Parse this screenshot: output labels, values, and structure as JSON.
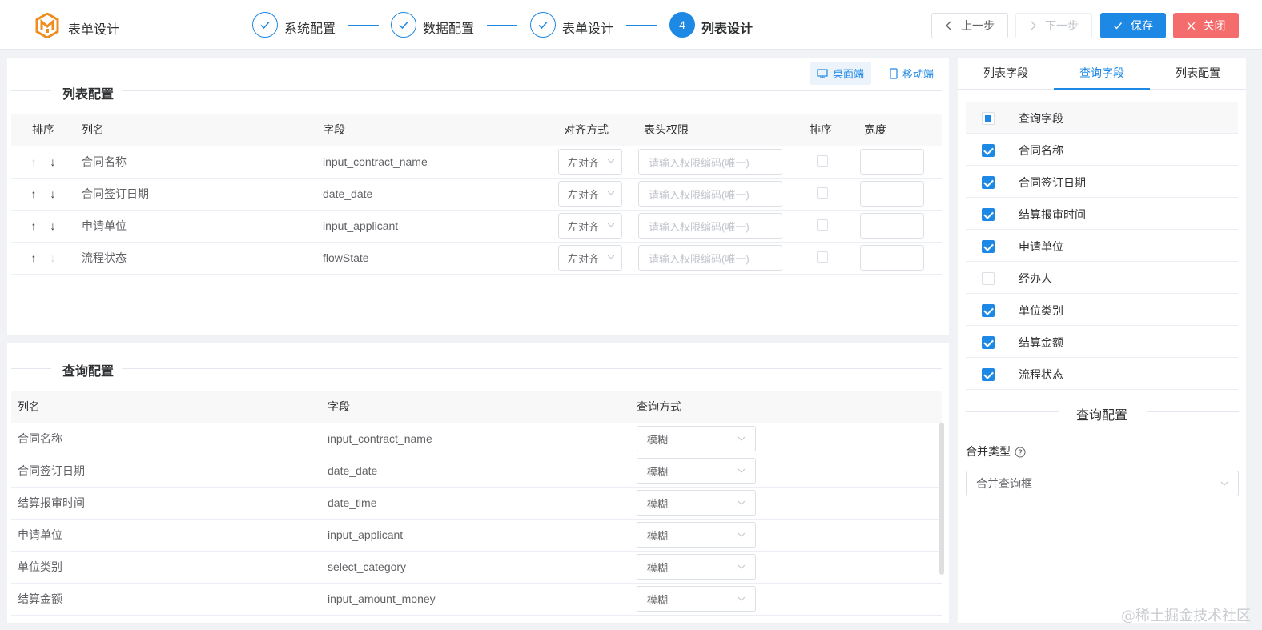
{
  "header": {
    "app_title": "表单设计",
    "steps": [
      {
        "num": "✓",
        "label": "系统配置"
      },
      {
        "num": "✓",
        "label": "数据配置"
      },
      {
        "num": "✓",
        "label": "表单设计"
      },
      {
        "num": "4",
        "label": "列表设计"
      }
    ],
    "prev_label": "上一步",
    "next_label": "下一步",
    "save_label": "保存",
    "close_label": "关闭",
    "brand_color": "#f08c1e",
    "accent_color": "#1e88e5",
    "danger_color": "#f56c6c"
  },
  "device": {
    "desktop": "桌面端",
    "mobile": "移动端"
  },
  "list_config": {
    "title": "列表配置",
    "headers": [
      "排序",
      "列名",
      "字段",
      "对齐方式",
      "表头权限",
      "排序",
      "宽度"
    ],
    "align_placeholder": "左对齐",
    "perm_placeholder": "请输入权限编码(唯一)",
    "rows": [
      {
        "name": "合同名称",
        "field": "input_contract_name",
        "up": false,
        "down": true
      },
      {
        "name": "合同签订日期",
        "field": "date_date",
        "up": true,
        "down": true
      },
      {
        "name": "申请单位",
        "field": "input_applicant",
        "up": true,
        "down": true
      },
      {
        "name": "流程状态",
        "field": "flowState",
        "up": true,
        "down": false
      }
    ]
  },
  "query_config": {
    "title": "查询配置",
    "headers": [
      "列名",
      "字段",
      "查询方式"
    ],
    "mode_value": "模糊",
    "rows": [
      {
        "name": "合同名称",
        "field": "input_contract_name"
      },
      {
        "name": "合同签订日期",
        "field": "date_date"
      },
      {
        "name": "结算报审时间",
        "field": "date_time"
      },
      {
        "name": "申请单位",
        "field": "input_applicant"
      },
      {
        "name": "单位类别",
        "field": "select_category"
      },
      {
        "name": "结算金额",
        "field": "input_amount_money"
      }
    ]
  },
  "right_panel": {
    "tabs": [
      "列表字段",
      "查询字段",
      "列表配置"
    ],
    "active_tab": 1,
    "field_header": "查询字段",
    "fields": [
      {
        "label": "合同名称",
        "checked": true
      },
      {
        "label": "合同签订日期",
        "checked": true
      },
      {
        "label": "结算报审时间",
        "checked": true
      },
      {
        "label": "申请单位",
        "checked": true
      },
      {
        "label": "经办人",
        "checked": false
      },
      {
        "label": "单位类别",
        "checked": true
      },
      {
        "label": "结算金额",
        "checked": true
      },
      {
        "label": "流程状态",
        "checked": true
      }
    ],
    "query_config_title": "查询配置",
    "merge_label": "合并类型",
    "merge_value": "合并查询框"
  },
  "watermark": "@稀土掘金技术社区"
}
